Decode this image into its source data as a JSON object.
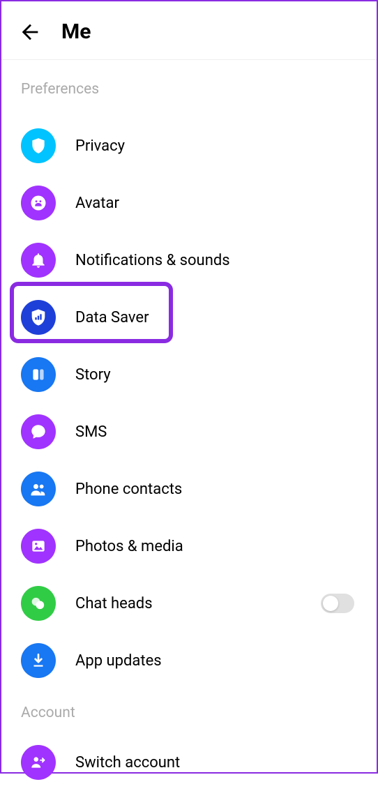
{
  "header": {
    "title": "Me"
  },
  "sections": {
    "preferences": {
      "label": "Preferences",
      "items": {
        "privacy": "Privacy",
        "avatar": "Avatar",
        "notifications": "Notifications & sounds",
        "data_saver": "Data Saver",
        "story": "Story",
        "sms": "SMS",
        "phone_contacts": "Phone contacts",
        "photos_media": "Photos & media",
        "chat_heads": "Chat heads",
        "app_updates": "App updates"
      }
    },
    "account": {
      "label": "Account",
      "items": {
        "switch_account": "Switch account"
      }
    }
  },
  "toggles": {
    "chat_heads": false
  },
  "colors": {
    "cyan": "#00c3ff",
    "purple": "#a033ff",
    "blue": "#1877f2",
    "royal": "#1e3fd8",
    "green": "#31cc46",
    "highlight": "#8a2be2"
  }
}
